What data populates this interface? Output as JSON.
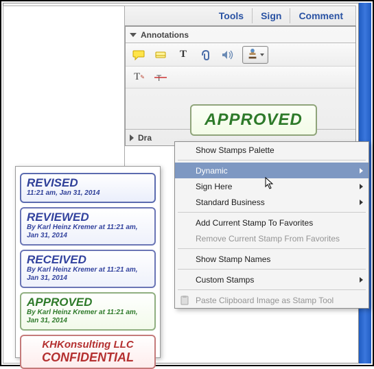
{
  "toolbar": {
    "tools": "Tools",
    "sign": "Sign",
    "comment": "Comment"
  },
  "panels": {
    "annotations": "Annotations",
    "drawing": "Dra"
  },
  "preview": {
    "approved": "APPROVED"
  },
  "menu": {
    "show_palette": "Show Stamps Palette",
    "dynamic": "Dynamic",
    "sign_here": "Sign Here",
    "standard_business": "Standard Business",
    "add_favorite": "Add Current Stamp To Favorites",
    "remove_favorite": "Remove Current Stamp From Favorites",
    "show_names": "Show Stamp Names",
    "custom_stamps": "Custom Stamps",
    "paste_clipboard": "Paste Clipboard Image as Stamp Tool"
  },
  "stamps": {
    "revised": {
      "title": "REVISED",
      "sub": "11:21 am, Jan 31, 2014"
    },
    "reviewed": {
      "title": "REVIEWED",
      "sub": "By Karl Heinz Kremer at 11:21 am, Jan 31, 2014"
    },
    "received": {
      "title": "RECEIVED",
      "sub": "By Karl Heinz Kremer at 11:21 am, Jan 31, 2014"
    },
    "approved": {
      "title": "APPROVED",
      "sub": "By Karl Heinz Kremer at 11:21 am, Jan 31, 2014"
    },
    "confidential": {
      "line1": "KHKonsulting LLC",
      "line2": "CONFIDENTIAL"
    }
  }
}
